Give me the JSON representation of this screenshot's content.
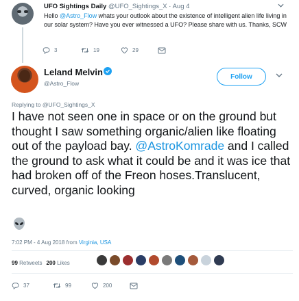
{
  "parent": {
    "name": "UFO Sightings Daily",
    "handle": "@UFO_Sightings_X",
    "sep": "·",
    "date": "Aug 4",
    "text_pre": "Hello ",
    "mention": "@Astro_Flow",
    "text_post": " whats your outlook about the existence of intelligent alien life living in our solar system? Have you ever witnessed a UFO? Please share with us. Thanks, SCW",
    "replies": "3",
    "retweets": "19",
    "likes": "29"
  },
  "main": {
    "name": "Leland Melvin",
    "handle": "@Astro_Flow",
    "follow_label": "Follow",
    "reply_to": "Replying to @UFO_Sightings_X",
    "text_pre": "I have not seen one in space or on the ground but thought I saw something organic/alien like floating out of the payload bay. ",
    "mention": "@AstroKomrade",
    "text_post": " and I called the ground to ask what it could be and it was ice that had broken off of the Freon hoses.Translucent, curved, organic looking",
    "timestamp_pre": "7:02 PM - 4 Aug 2018 from ",
    "location": "Virginia, USA",
    "retweet_count": "99",
    "retweet_label": "Retweets",
    "like_count": "200",
    "like_label": "Likes",
    "replies": "37",
    "retweets": "99",
    "likes": "200"
  },
  "colors": {
    "link": "#1b95e0",
    "accent": "#1da1f2",
    "muted": "#657786",
    "liker_avatars": [
      "#3a3a3a",
      "#7a4b2a",
      "#9c2f2f",
      "#2a3d66",
      "#b24b2e",
      "#7a7a7a",
      "#1e4f7a",
      "#a55a3c",
      "#c9d3dc",
      "#2f3b52"
    ]
  },
  "icons": {
    "reply": "reply-icon",
    "retweet": "retweet-icon",
    "like": "heart-icon",
    "dm": "envelope-icon",
    "verified": "verified-badge-icon",
    "chevron": "chevron-down-icon",
    "alien": "alien-emoji-icon"
  }
}
